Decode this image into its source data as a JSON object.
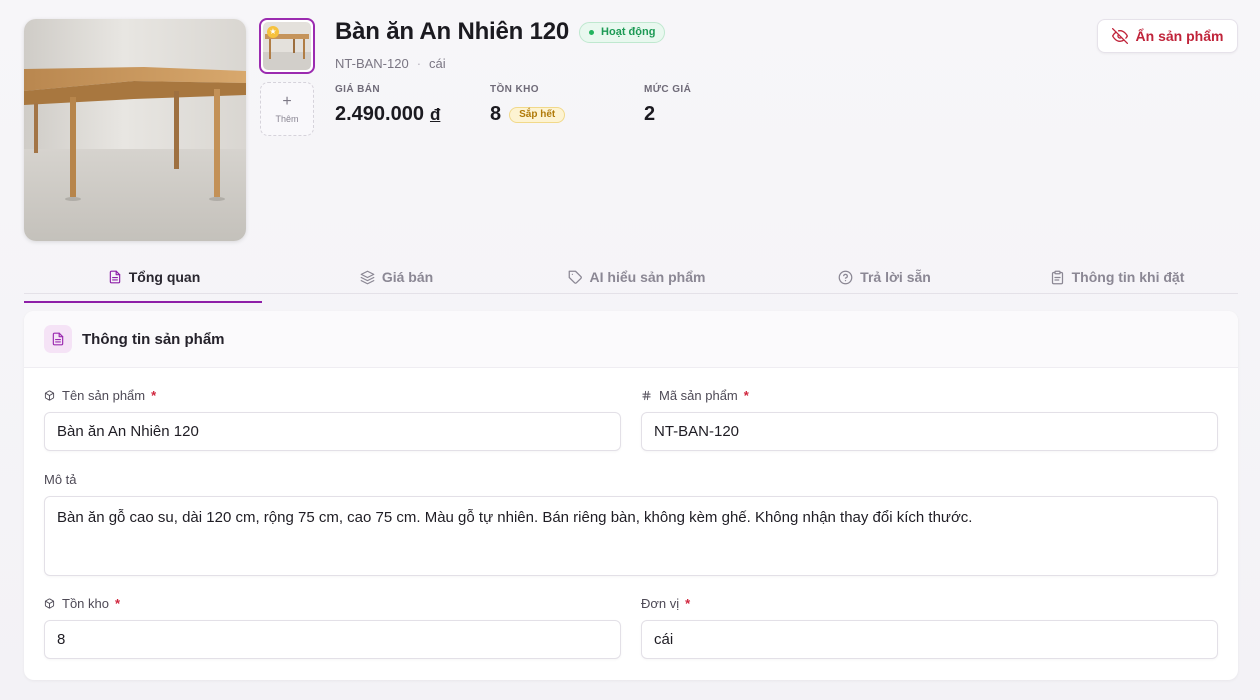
{
  "header": {
    "add_image_label": "Thêm",
    "product_title": "Bàn ăn An Nhiên 120",
    "status_badge": "Hoạt động",
    "sku": "NT-BAN-120",
    "unit": "cái",
    "hide_button": "Ẩn sản phẩm",
    "stats": {
      "price_label": "GIÁ BÁN",
      "price_value": "2.490.000",
      "currency": "đ",
      "stock_label": "TỒN KHO",
      "stock_value": "8",
      "stock_badge": "Sắp hết",
      "price_level_label": "MỨC GIÁ",
      "price_level_value": "2"
    }
  },
  "tabs": [
    {
      "label": "Tổng quan",
      "icon": "document-icon",
      "active": true
    },
    {
      "label": "Giá bán",
      "icon": "layers-icon",
      "active": false
    },
    {
      "label": "AI hiểu sản phẩm",
      "icon": "tag-icon",
      "active": false
    },
    {
      "label": "Trả lời sẵn",
      "icon": "help-circle-icon",
      "active": false
    },
    {
      "label": "Thông tin khi đặt",
      "icon": "clipboard-icon",
      "active": false
    }
  ],
  "card": {
    "title": "Thông tin sản phẩm",
    "fields": {
      "name": {
        "label": "Tên sản phẩm",
        "required": "*",
        "value": "Bàn ăn An Nhiên 120"
      },
      "sku": {
        "label": "Mã sản phẩm",
        "required": "*",
        "value": "NT-BAN-120"
      },
      "description": {
        "label": "Mô tả",
        "value": "Bàn ăn gỗ cao su, dài 120 cm, rộng 75 cm, cao 75 cm. Màu gỗ tự nhiên. Bán riêng bàn, không kèm ghế. Không nhận thay đổi kích thước."
      },
      "stock": {
        "label": "Tồn kho",
        "required": "*",
        "value": "8"
      },
      "unit": {
        "label": "Đơn vị",
        "required": "*",
        "value": "cái"
      }
    }
  },
  "colors": {
    "accent": "#8e1fa8",
    "status_green": "#1d9a55",
    "warning": "#b07a09",
    "danger": "#c0243a"
  }
}
